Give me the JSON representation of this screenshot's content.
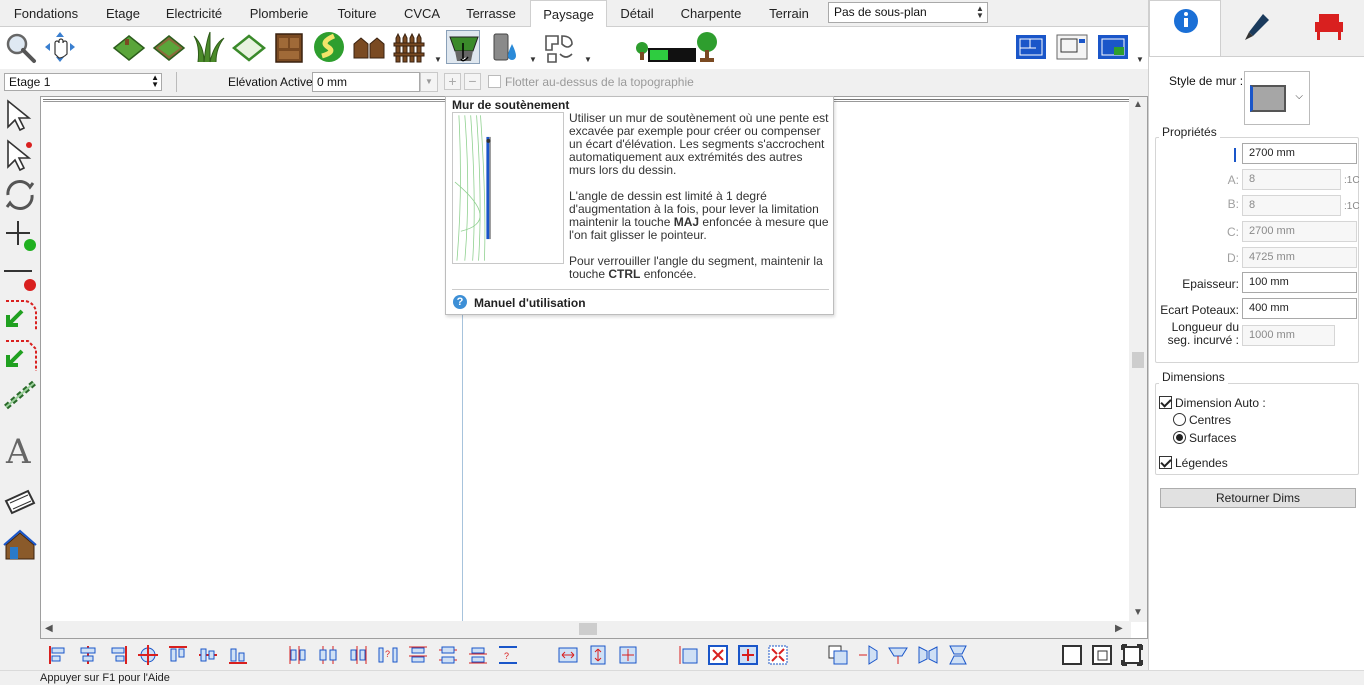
{
  "tabs": [
    {
      "label": "Fondations",
      "active": false
    },
    {
      "label": "Etage",
      "active": false
    },
    {
      "label": "Electricité",
      "active": false
    },
    {
      "label": "Plomberie",
      "active": false
    },
    {
      "label": "Toiture",
      "active": false
    },
    {
      "label": "CVCA",
      "active": false
    },
    {
      "label": "Terrasse",
      "active": false
    },
    {
      "label": "Paysage",
      "active": true
    },
    {
      "label": "Détail",
      "active": false
    },
    {
      "label": "Charpente",
      "active": false
    },
    {
      "label": "Terrain",
      "active": false
    }
  ],
  "subplan_select": "Pas de sous-plan",
  "options_row": {
    "floor_select": "Etage 1",
    "elevation_label": "Elévation Active:",
    "elevation_value": "0 mm",
    "float_label": "Flotter au-dessus de la topographie"
  },
  "tooltip": {
    "title": "Mur de soutènement",
    "para1": "Utiliser un mur de soutènement où une pente est excavée par exemple pour créer ou compenser un écart d'élévation. Les segments s'accrochent automatiquement aux extrémités des autres murs lors du dessin.",
    "para2_a": "L'angle de dessin est limité à 1 degré d'augmentation à la fois, pour lever la limitation maintenir la touche ",
    "para2_key": "MAJ",
    "para2_b": " enfoncée à mesure que l'on fait glisser le pointeur.",
    "para3_a": "Pour verrouiller l'angle du segment, maintenir la touche ",
    "para3_key": "CTRL",
    "para3_b": " enfoncée.",
    "manual_link": "Manuel d'utilisation"
  },
  "right_panel": {
    "wall_style_label": "Style de mur :",
    "properties": {
      "group_label": "Propriétés",
      "height": "2700 mm",
      "a_label": "A:",
      "a_value": "8",
      "a_suffix": ":1C",
      "b_label": "B:",
      "b_value": "8",
      "b_suffix": ":1C",
      "c_label": "C:",
      "c_value": "2700 mm",
      "d_label": "D:",
      "d_value": "4725 mm",
      "thickness_label": "Epaisseur:",
      "thickness_value": "100 mm",
      "post_spacing_label": "Ecart Poteaux:",
      "post_spacing_value": "400 mm",
      "curved_seg_label_1": "Longueur du",
      "curved_seg_label_2": "seg. incurvé :",
      "curved_seg_value": "1000 mm"
    },
    "dimensions": {
      "group_label": "Dimensions",
      "auto_dimension": "Dimension Auto :",
      "auto_dimension_checked": true,
      "option_centers": "Centres",
      "option_surfaces": "Surfaces",
      "selected_option": "Surfaces",
      "legends": "Légendes",
      "legends_checked": true
    },
    "return_dims_button": "Retourner Dims"
  },
  "status_bar": "Appuyer sur F1 pour l'Aide",
  "colors": {
    "accent_blue": "#1a6fd6",
    "brand_green": "#2e9e2e",
    "alert_red": "#d9201f",
    "canvas_guide": "#a7c3dc"
  }
}
